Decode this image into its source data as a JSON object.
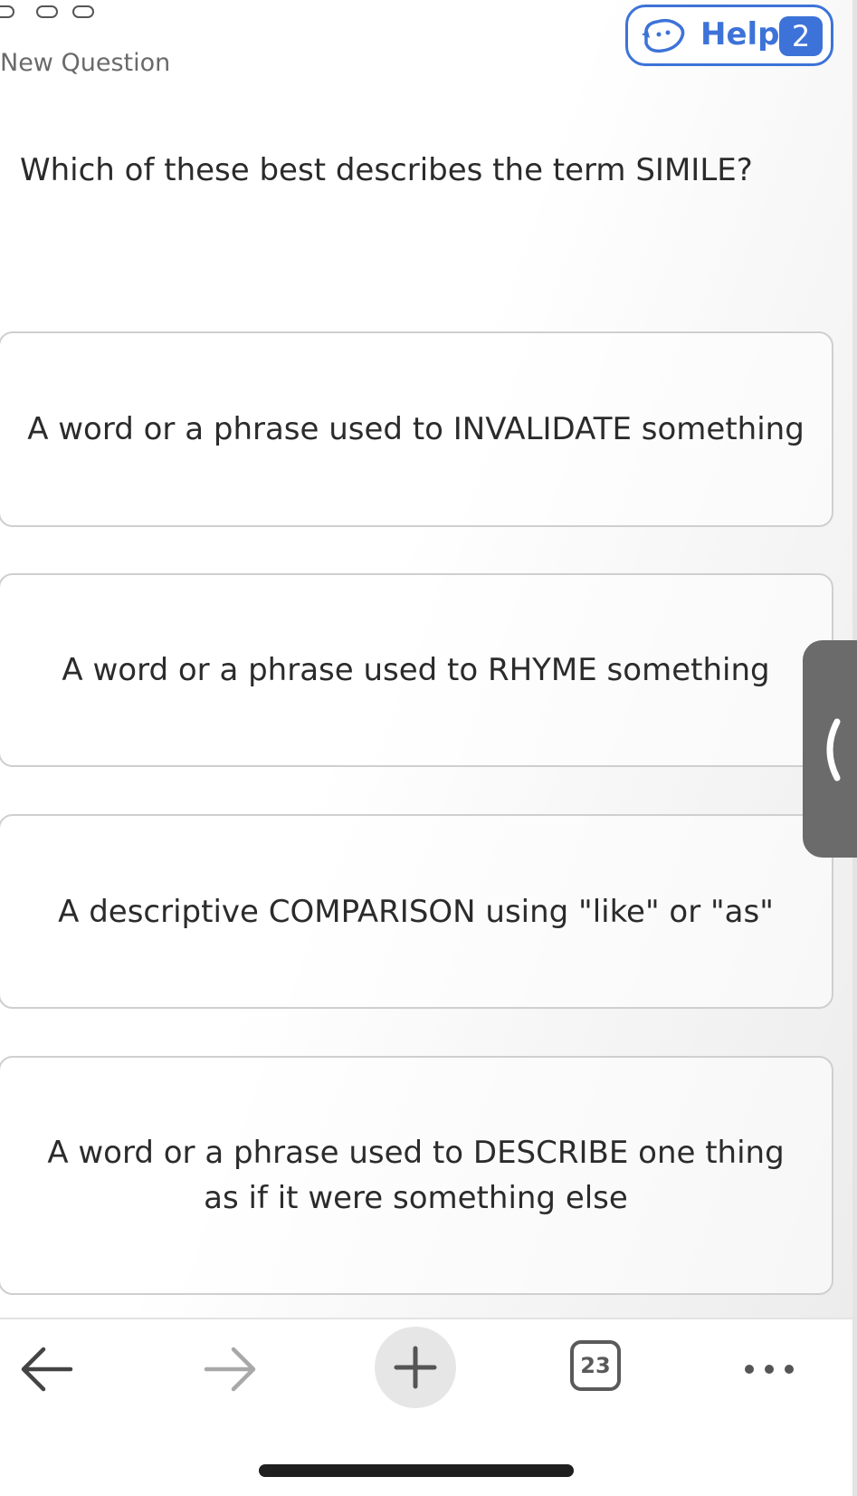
{
  "header": {
    "title": "New Question",
    "help": {
      "label": "Help",
      "count": "2",
      "icon": "question-mascot-icon",
      "color": "#3d73d8"
    }
  },
  "question": {
    "text": "Which of these best describes the term SIMILE?"
  },
  "answers": [
    {
      "text": "A word or a phrase used to INVALIDATE something"
    },
    {
      "text": "A word or a phrase used to RHYME something"
    },
    {
      "text": "A descriptive COMPARISON using \"like\" or \"as\""
    },
    {
      "text": "A word or a phrase used to DESCRIBE one thing as if it were something else"
    }
  ],
  "side_tab": {
    "icon": "chevron-left-icon"
  },
  "toolbar": {
    "back_icon": "arrow-left-icon",
    "forward_icon": "arrow-right-icon",
    "add_icon": "plus-icon",
    "tab_count": "23",
    "more_icon": "more-horizontal-icon"
  }
}
